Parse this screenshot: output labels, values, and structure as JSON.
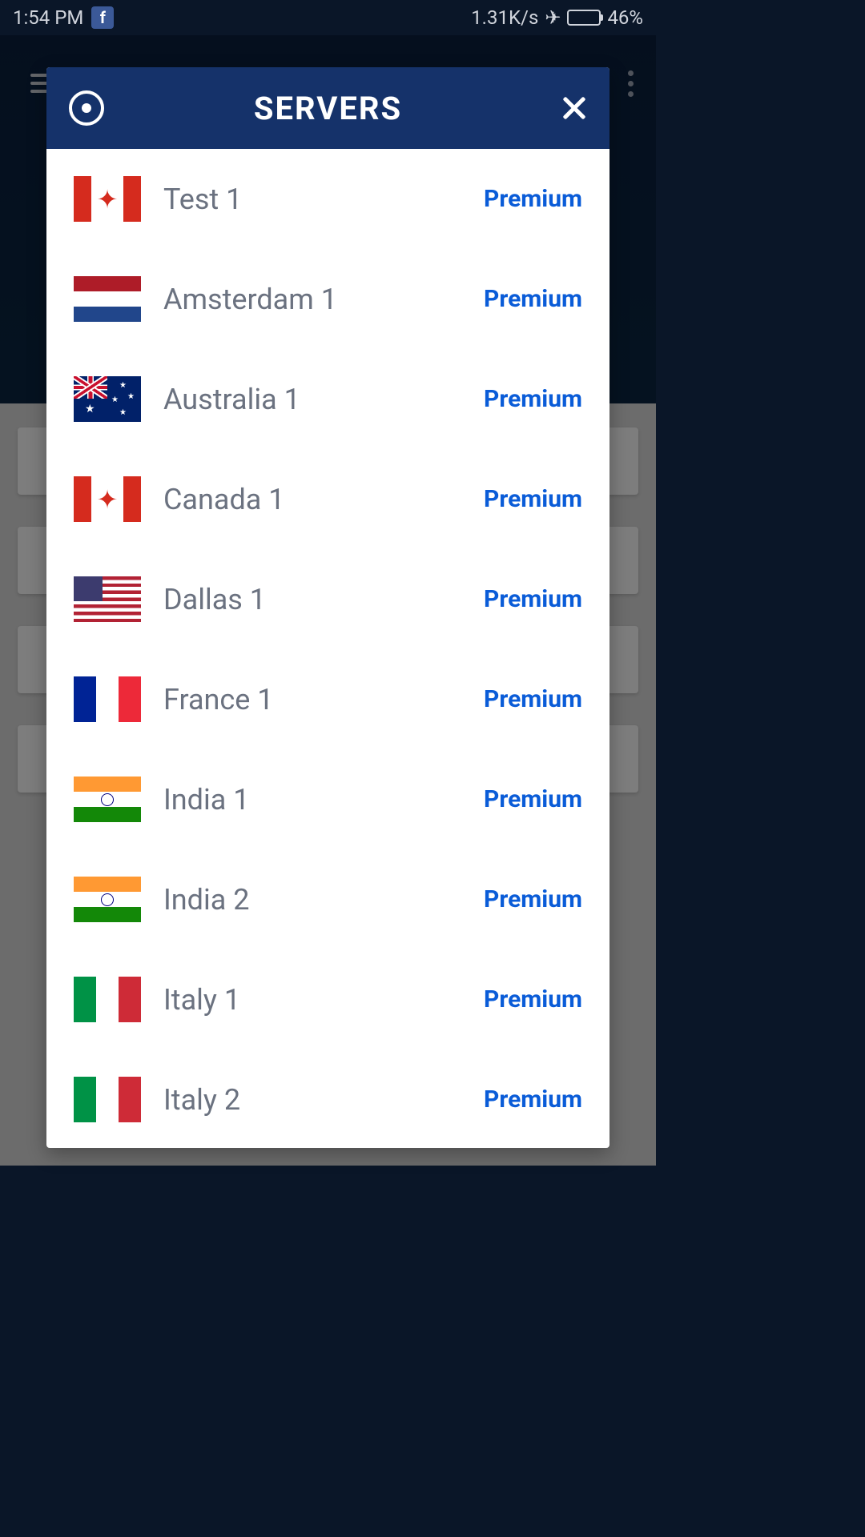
{
  "status": {
    "time": "1:54 PM",
    "speed": "1.31K/s",
    "battery_percent": "46%"
  },
  "modal": {
    "title": "SERVERS",
    "premium_label": "Premium",
    "servers": [
      {
        "name": "Test 1",
        "flag": "canada",
        "tier": "Premium"
      },
      {
        "name": "Amsterdam 1",
        "flag": "netherlands",
        "tier": "Premium"
      },
      {
        "name": "Australia 1",
        "flag": "australia",
        "tier": "Premium"
      },
      {
        "name": "Canada 1",
        "flag": "canada",
        "tier": "Premium"
      },
      {
        "name": "Dallas 1",
        "flag": "usa",
        "tier": "Premium"
      },
      {
        "name": "France 1",
        "flag": "france",
        "tier": "Premium"
      },
      {
        "name": "India 1",
        "flag": "india",
        "tier": "Premium"
      },
      {
        "name": "India 2",
        "flag": "india",
        "tier": "Premium"
      },
      {
        "name": "Italy 1",
        "flag": "italy",
        "tier": "Premium"
      },
      {
        "name": "Italy 2",
        "flag": "italy",
        "tier": "Premium"
      }
    ]
  }
}
